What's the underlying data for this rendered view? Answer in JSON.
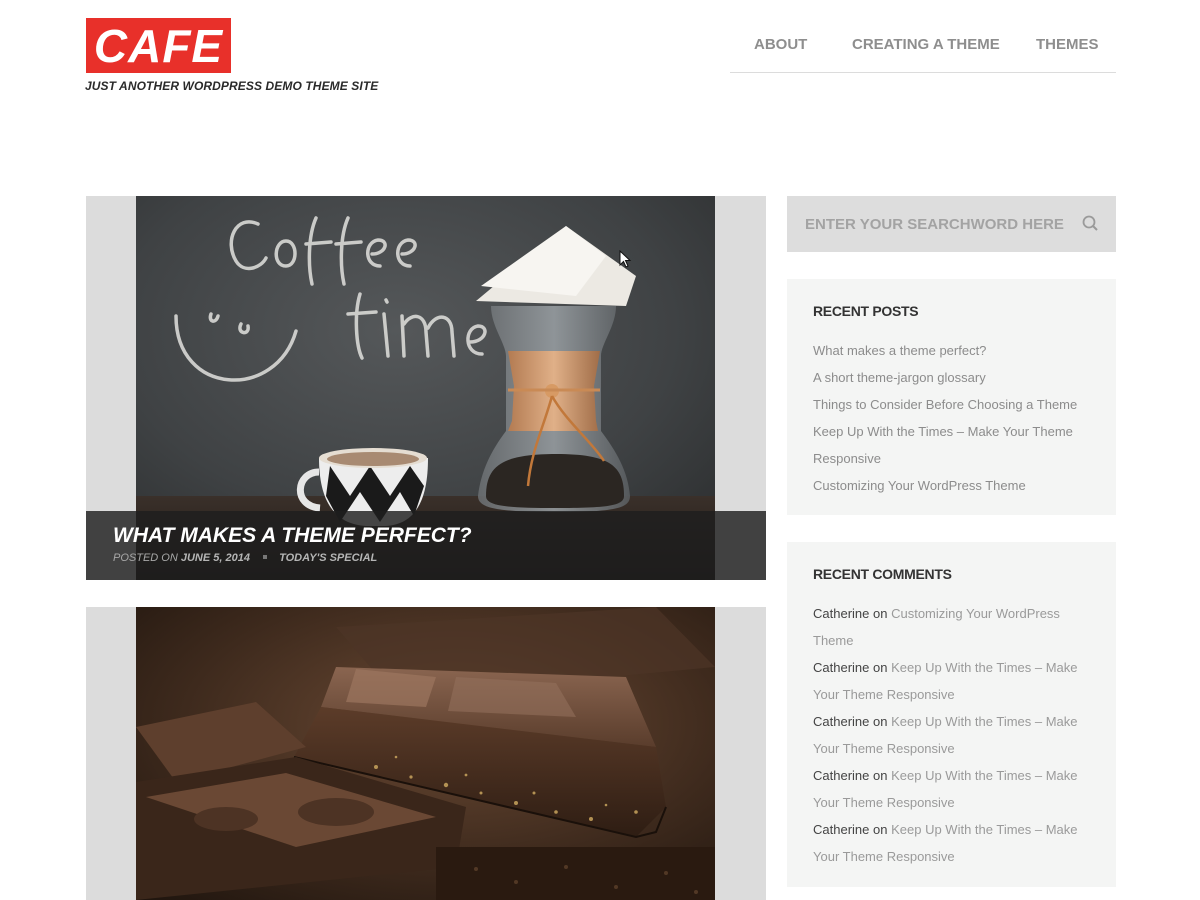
{
  "header": {
    "logo_text": "CAFE",
    "tagline": "JUST ANOTHER WORDPRESS DEMO THEME SITE",
    "brand_color": "#e8302a",
    "nav": [
      {
        "label": "ABOUT"
      },
      {
        "label": "CREATING A THEME"
      },
      {
        "label": "THEMES"
      }
    ]
  },
  "posts": [
    {
      "title": "WHAT MAKES A THEME PERFECT?",
      "posted_on_label": "POSTED ON",
      "date": "JUNE 5, 2014",
      "category": "TODAY'S SPECIAL",
      "image": "coffee-chemex-chalkboard-photo"
    },
    {
      "image": "chocolate-bars-photo"
    }
  ],
  "search": {
    "placeholder": "ENTER YOUR SEARCHWORD HERE",
    "icon": "search-icon"
  },
  "recent_posts": {
    "title": "RECENT POSTS",
    "items": [
      "What makes a theme perfect?",
      "A short theme-jargon glossary",
      "Things to Consider Before Choosing a Theme",
      "Keep Up With the Times – Make Your Theme Responsive",
      "Customizing Your WordPress Theme"
    ]
  },
  "recent_comments": {
    "title": "RECENT COMMENTS",
    "on_word": "on",
    "items": [
      {
        "author": "Catherine",
        "post": "Customizing Your WordPress Theme"
      },
      {
        "author": "Catherine",
        "post": "Keep Up With the Times – Make Your Theme Responsive"
      },
      {
        "author": "Catherine",
        "post": "Keep Up With the Times – Make Your Theme Responsive"
      },
      {
        "author": "Catherine",
        "post": "Keep Up With the Times – Make Your Theme Responsive"
      },
      {
        "author": "Catherine",
        "post": "Keep Up With the Times – Make Your Theme Responsive"
      }
    ]
  }
}
